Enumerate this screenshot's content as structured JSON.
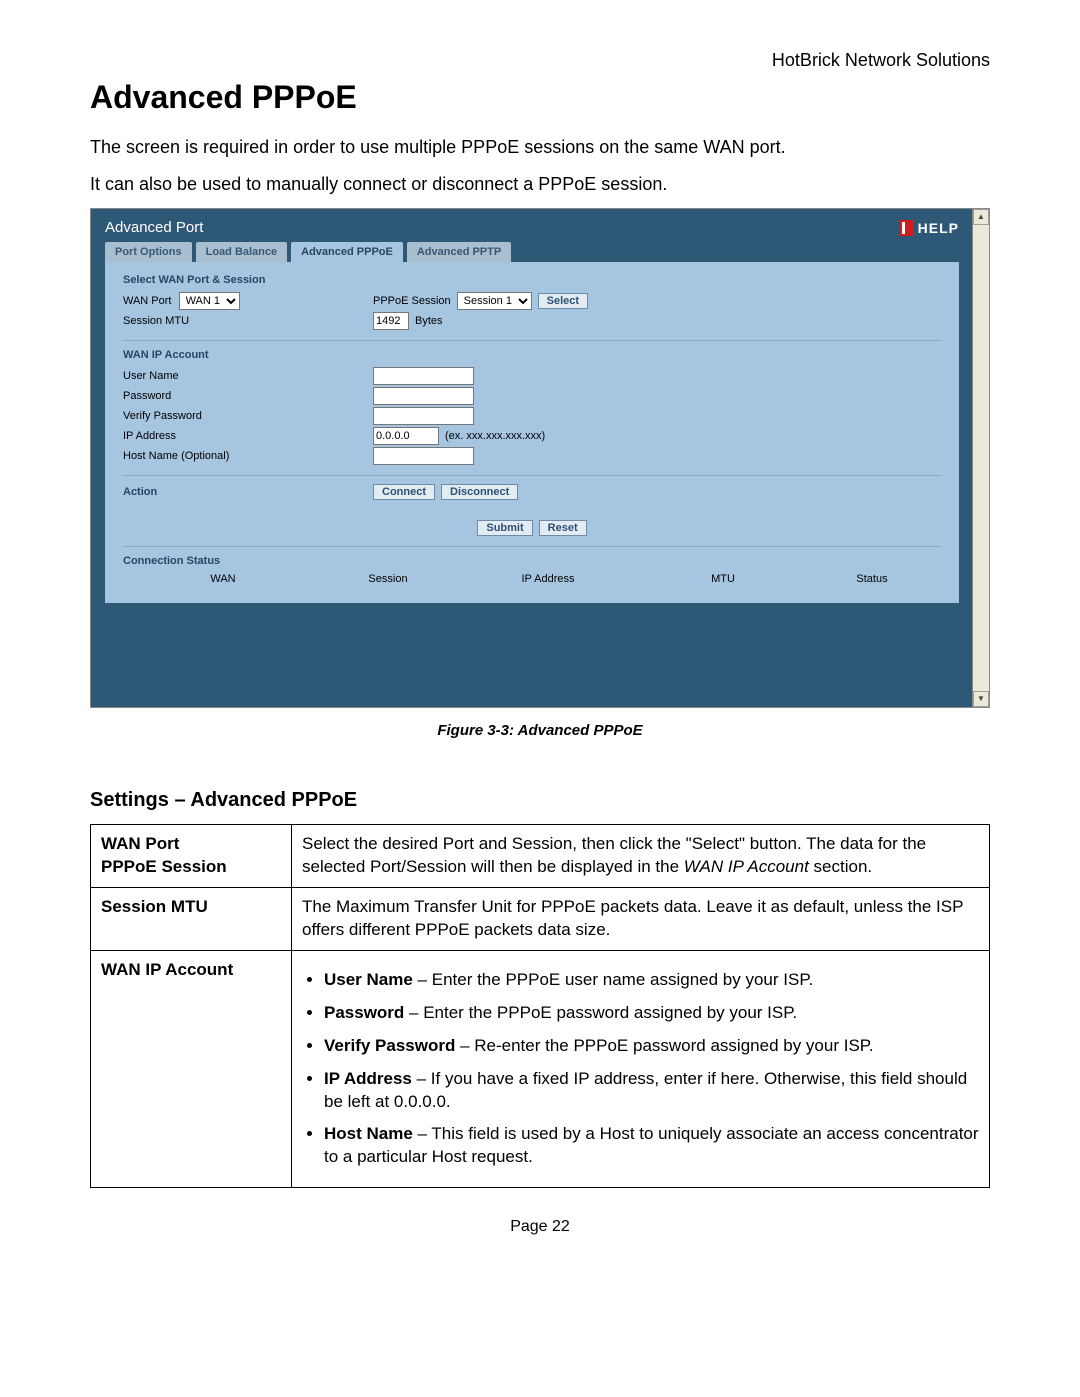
{
  "header_company": "HotBrick Network Solutions",
  "title": "Advanced PPPoE",
  "intro_line1": "The screen is required in order to use multiple PPPoE sessions on the same WAN port.",
  "intro_line2": "It can also be used to manually connect or disconnect a PPPoE session.",
  "figure_caption": "Figure 3-3: Advanced PPPoE",
  "page_number": "Page 22",
  "screenshot": {
    "panel_title": "Advanced Port",
    "help_label": "HELP",
    "tabs": {
      "t1": "Port Options",
      "t2": "Load Balance",
      "t3": "Advanced PPPoE",
      "t4": "Advanced PPTP"
    },
    "section1_title": "Select WAN Port & Session",
    "wan_port_label": "WAN Port",
    "wan_port_opt": "WAN 1",
    "pppoe_session_label": "PPPoE Session",
    "pppoe_session_opt": "Session 1",
    "select_btn": "Select",
    "session_mtu_label": "Session MTU",
    "mtu_value": "1492",
    "mtu_unit": "Bytes",
    "section2_title": "WAN IP Account",
    "user_name_label": "User Name",
    "password_label": "Password",
    "verify_password_label": "Verify Password",
    "ip_address_label": "IP Address",
    "ip_address_value": "0.0.0.0",
    "ip_hint": "(ex. xxx.xxx.xxx.xxx)",
    "hostname_label": "Host Name (Optional)",
    "action_label": "Action",
    "connect_btn": "Connect",
    "disconnect_btn": "Disconnect",
    "submit_btn": "Submit",
    "reset_btn": "Reset",
    "conn_status_label": "Connection Status",
    "col_wan": "WAN",
    "col_session": "Session",
    "col_ip": "IP Address",
    "col_mtu": "MTU",
    "col_status": "Status"
  },
  "settings_heading": "Settings – Advanced PPPoE",
  "table": {
    "r1k_line1": "WAN Port",
    "r1k_line2": "PPPoE Session",
    "r1v_a": "Select the desired Port and Session, then click the \"Select\" button. The data for the selected Port/Session will then be displayed in the ",
    "r1v_b": "WAN IP Account",
    "r1v_c": " section.",
    "r2k": "Session MTU",
    "r2v": "The Maximum Transfer Unit for PPPoE packets data. Leave it as default, unless the ISP offers different PPPoE packets data size.",
    "r3k": "WAN IP Account",
    "r3": {
      "b1_strong": "User Name",
      "b1_rest": " – Enter the PPPoE user name assigned by your ISP.",
      "b2_strong": "Password",
      "b2_rest": " – Enter the PPPoE password assigned by your ISP.",
      "b3_strong": "Verify Password",
      "b3_rest": " – Re-enter the PPPoE password assigned by your ISP.",
      "b4_strong": "IP Address",
      "b4_rest": " – If you have a fixed IP address, enter if here. Otherwise, this field should be left at 0.0.0.0.",
      "b5_strong": "Host Name",
      "b5_rest": " – This field is used by a Host to uniquely associate an access concentrator to a particular Host request."
    }
  }
}
